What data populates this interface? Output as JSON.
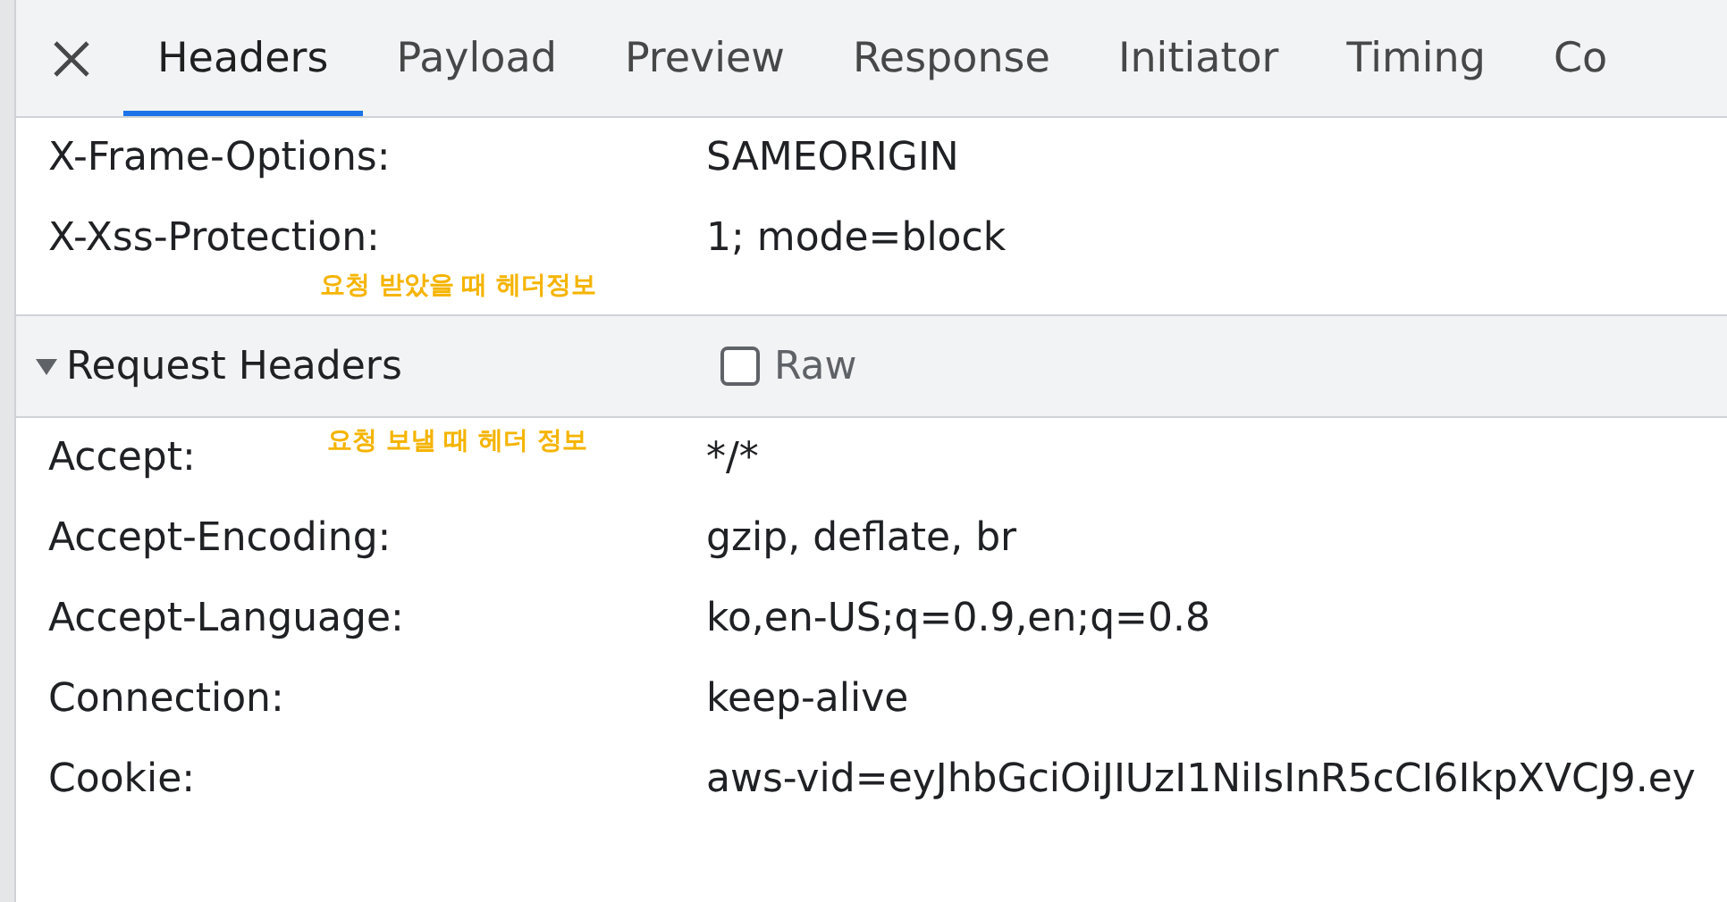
{
  "tabs": [
    {
      "label": "Headers",
      "selected": true
    },
    {
      "label": "Payload",
      "selected": false
    },
    {
      "label": "Preview",
      "selected": false
    },
    {
      "label": "Response",
      "selected": false
    },
    {
      "label": "Initiator",
      "selected": false
    },
    {
      "label": "Timing",
      "selected": false
    },
    {
      "label": "Co",
      "selected": false
    }
  ],
  "response_headers": {
    "rows": [
      {
        "name": "X-Frame-Options:",
        "value": "SAMEORIGIN"
      },
      {
        "name": "X-Xss-Protection:",
        "value": "1; mode=block"
      }
    ],
    "note": "요청 받았을 때 헤더정보"
  },
  "request_headers": {
    "title": "Request Headers",
    "expanded": true,
    "raw": {
      "label": "Raw",
      "checked": false
    },
    "note": "요청 보낼 때 헤더 정보",
    "rows": [
      {
        "name": "Accept:",
        "value": "*/*"
      },
      {
        "name": "Accept-Encoding:",
        "value": "gzip, deflate, br"
      },
      {
        "name": "Accept-Language:",
        "value": "ko,en-US;q=0.9,en;q=0.8"
      },
      {
        "name": "Connection:",
        "value": "keep-alive"
      },
      {
        "name": "Cookie:",
        "value": "aws-vid=eyJhbGciOiJIUzI1NiIsInR5cCI6IkpXVCJ9.ey"
      }
    ]
  }
}
